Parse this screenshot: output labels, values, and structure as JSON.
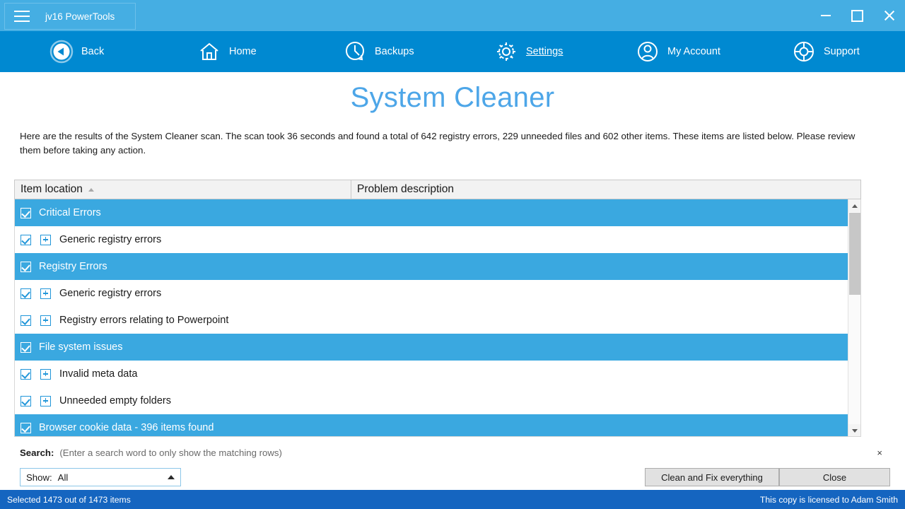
{
  "window": {
    "app_title": "jv16 PowerTools",
    "menu_icon": "hamburger-icon",
    "minimize_label": "Minimize",
    "maximize_label": "Maximize",
    "close_label": "Close",
    "titlebar_color": "#45aee3",
    "navbar_color": "#0089d1"
  },
  "nav": {
    "items": [
      {
        "label": "Back",
        "icon": "back-arrow-circle-icon",
        "active": false
      },
      {
        "label": "Home",
        "icon": "house-icon",
        "active": false
      },
      {
        "label": "Backups",
        "icon": "clock-restore-icon",
        "active": false
      },
      {
        "label": "Settings",
        "icon": "gear-icon",
        "active": true
      },
      {
        "label": "My Account",
        "icon": "user-circle-icon",
        "active": false
      },
      {
        "label": "Support",
        "icon": "lifebuoy-icon",
        "active": false
      }
    ]
  },
  "page": {
    "title": "System Cleaner",
    "title_color": "#4da6e8",
    "intro": "Here are the results of the System Cleaner scan. The scan took 36 seconds and found a total of 642 registry errors, 229 unneeded files and 602 other items. These items are listed below. Please review them before taking any action."
  },
  "table": {
    "columns": [
      {
        "label": "Item location",
        "sorted": "ascending"
      },
      {
        "label": "Problem description",
        "sorted": ""
      }
    ],
    "rows": [
      {
        "type": "group",
        "label": "Critical Errors",
        "checked": true,
        "description": ""
      },
      {
        "type": "child",
        "label": "Generic registry errors",
        "checked": true,
        "expandable": true,
        "description": ""
      },
      {
        "type": "group",
        "label": "Registry Errors",
        "checked": true,
        "description": ""
      },
      {
        "type": "child",
        "label": "Generic registry errors",
        "checked": true,
        "expandable": true,
        "description": ""
      },
      {
        "type": "child",
        "label": "Registry errors relating to Powerpoint",
        "checked": true,
        "expandable": true,
        "description": ""
      },
      {
        "type": "group",
        "label": "File system issues",
        "checked": true,
        "description": ""
      },
      {
        "type": "child",
        "label": "Invalid meta data",
        "checked": true,
        "expandable": true,
        "description": ""
      },
      {
        "type": "child",
        "label": "Unneeded empty folders",
        "checked": true,
        "expandable": true,
        "description": ""
      },
      {
        "type": "group",
        "label": "Browser cookie data - 396 items found",
        "checked": true,
        "description": ""
      }
    ],
    "group_row_color": "#3aa8e0"
  },
  "search": {
    "label": "Search:",
    "value": "",
    "placeholder": "(Enter a search word to only show the matching rows)",
    "close_glyph": "×"
  },
  "filter": {
    "label": "Show:",
    "value": "All",
    "caret": "caret-up-icon"
  },
  "actions": {
    "clean_label": "Clean and Fix everything",
    "close_label": "Close"
  },
  "status": {
    "left": "Selected 1473 out of 1473 items",
    "right": "This copy is licensed to Adam Smith"
  }
}
